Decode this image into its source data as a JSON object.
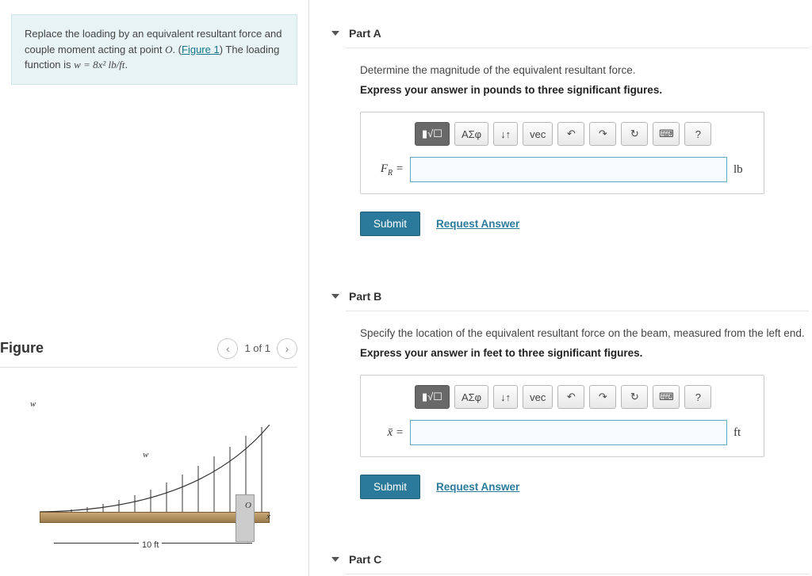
{
  "problem": {
    "text_before_link": "Replace the loading by an equivalent resultant force and couple moment acting at point ",
    "point": "O",
    "text_after_point": ". (",
    "figure_link": "Figure 1",
    "text_after_link": ") The loading function is ",
    "equation": "w = 8x² lb/ft",
    "period": "."
  },
  "figure": {
    "title": "Figure",
    "pager_text": "1 of 1",
    "dim_label": "10 ft",
    "w_label": "w",
    "o_label": "O",
    "x_label": "x"
  },
  "parts": [
    {
      "title": "Part A",
      "prompt": "Determine the magnitude of the equivalent resultant force.",
      "instruction": "Express your answer in pounds to three significant figures.",
      "var_html": "F_R",
      "unit": "lb",
      "submit": "Submit",
      "request": "Request Answer"
    },
    {
      "title": "Part B",
      "prompt": "Specify the location of the equivalent resultant force on the beam, measured from the left end.",
      "instruction": "Express your answer in feet to three significant figures.",
      "var_html": "x̄",
      "unit": "ft",
      "submit": "Submit",
      "request": "Request Answer"
    },
    {
      "title": "Part C"
    }
  ],
  "toolbar": {
    "templates": "▮√☐",
    "greek": "ΑΣφ",
    "subscript": "↓↑",
    "vec": "vec",
    "undo": "↶",
    "redo": "↷",
    "reset": "↻",
    "keyboard": "⌨",
    "help": "?"
  }
}
